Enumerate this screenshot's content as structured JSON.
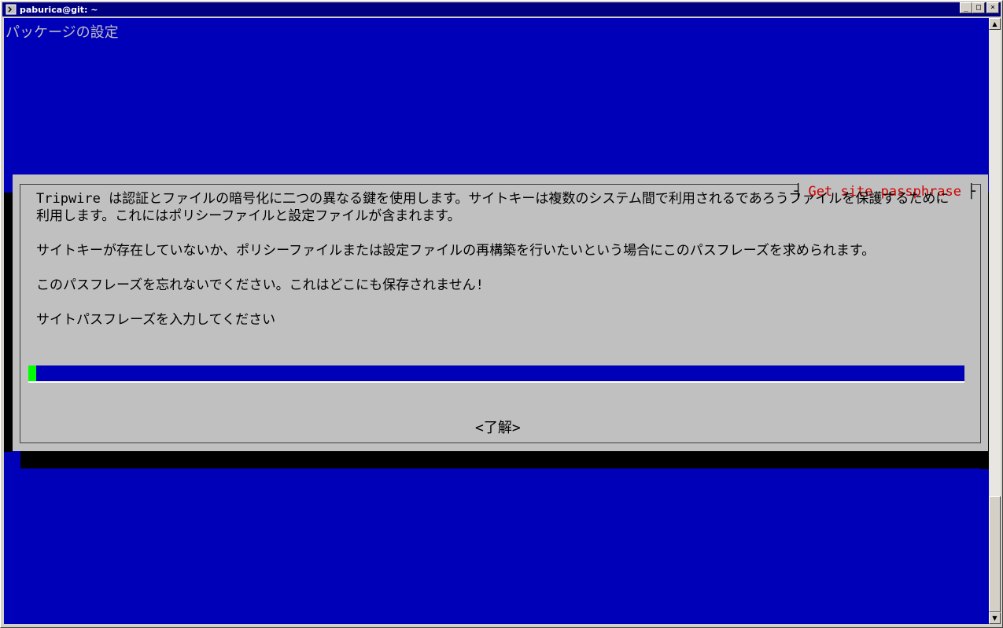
{
  "window": {
    "title": "paburica@git: ~",
    "minimize_glyph": "_",
    "maximize_glyph": "□",
    "close_glyph": "×",
    "app_icon": "terminal-icon"
  },
  "terminal": {
    "heading": "パッケージの設定",
    "background": "#0000b8"
  },
  "dialog": {
    "title": "Get site passphrase",
    "paragraphs": [
      "Tripwire は認証とファイルの暗号化に二つの異なる鍵を使用します。サイトキーは複数のシステム間で利用されるであろうファイルを保護するために利用します。これにはポリシーファイルと設定ファイルが含まれます。",
      "サイトキーが存在していないか、ポリシーファイルまたは設定ファイルの再構築を行いたいという場合にこのパスフレーズを求められます。",
      "このパスフレーズを忘れないでください。これはどこにも保存されません!",
      "サイトパスフレーズを入力してください"
    ],
    "input_value": "",
    "ok_label": "<了解>",
    "title_color": "#d00000",
    "cursor_color": "#00ff00"
  },
  "scrollbar": {
    "up_glyph": "▲",
    "down_glyph": "▼"
  }
}
